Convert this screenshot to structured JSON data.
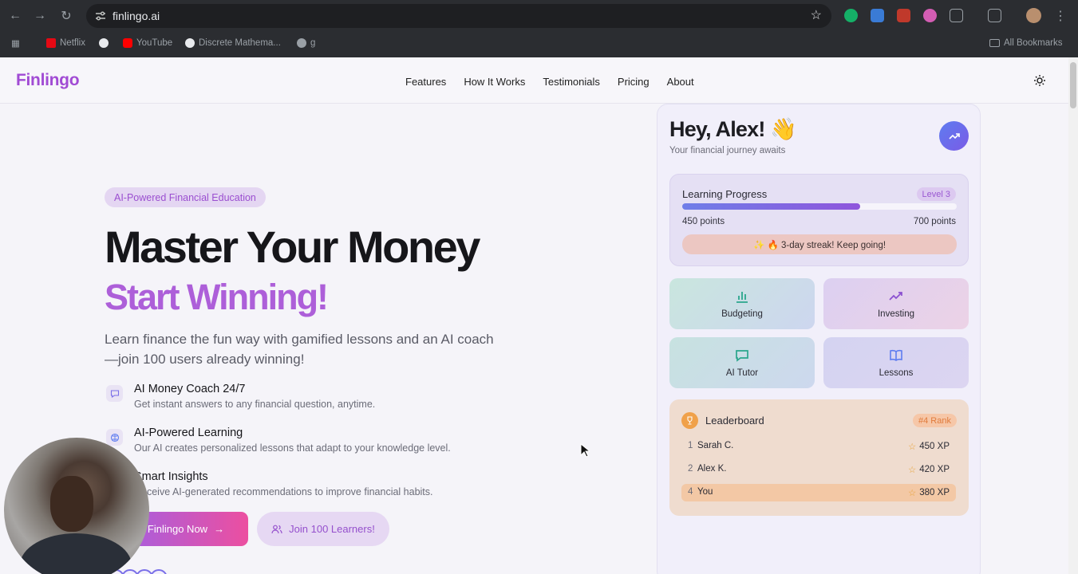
{
  "browser": {
    "url": "finlingo.ai",
    "bookmarks": [
      "Netflix",
      "YouTube",
      "Discrete Mathema...",
      "g"
    ],
    "all_bookmarks": "All Bookmarks"
  },
  "nav": {
    "logo": "Finlingo",
    "links": [
      "Features",
      "How It Works",
      "Testimonials",
      "Pricing",
      "About"
    ]
  },
  "hero": {
    "badge": "AI-Powered Financial Education",
    "title": "Master Your Money",
    "subtitle": "Start Winning!",
    "lead": "Learn finance the fun way with gamified lessons and an AI coach—join 100 users already winning!",
    "features": [
      {
        "title": "AI Money Coach 24/7",
        "desc": "Get instant answers to any financial question, anytime."
      },
      {
        "title": "AI-Powered Learning",
        "desc": "Our AI creates personalized lessons that adapt to your knowledge level."
      },
      {
        "title": "Smart Insights",
        "desc": "Receive AI-generated recommendations to improve financial habits."
      }
    ],
    "cta_primary": "Finlingo Now",
    "cta_secondary": "Join 100 Learners!"
  },
  "dashboard": {
    "greeting": "Hey, Alex! 👋",
    "tagline": "Your financial journey awaits",
    "progress": {
      "title": "Learning Progress",
      "level": "Level 3",
      "current": "450 points",
      "goal": "700 points",
      "fraction": 0.648,
      "streak": "✨ 🔥 3-day streak! Keep going!"
    },
    "tiles": [
      "Budgeting",
      "Investing",
      "AI Tutor",
      "Lessons"
    ],
    "leaderboard": {
      "title": "Leaderboard",
      "rank": "#4 Rank",
      "rows": [
        {
          "num": "1",
          "name": "Sarah C.",
          "xp": "450 XP"
        },
        {
          "num": "2",
          "name": "Alex K.",
          "xp": "420 XP"
        },
        {
          "num": "4",
          "name": "You",
          "xp": "380 XP"
        }
      ]
    }
  },
  "colors": {
    "brand": "#a14bd4",
    "accent": "#ad5fd9"
  }
}
